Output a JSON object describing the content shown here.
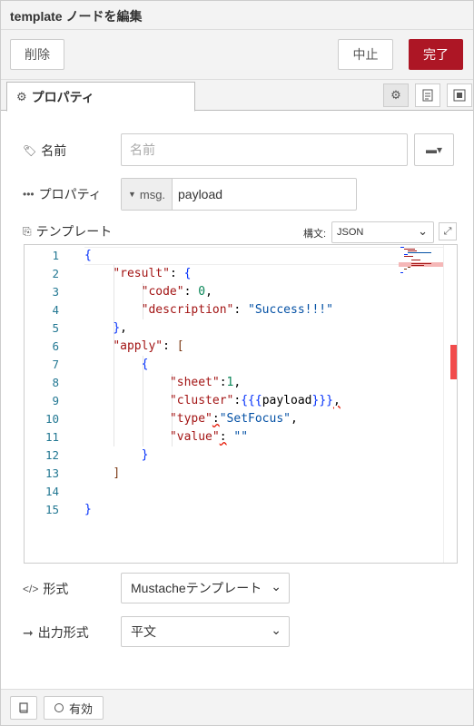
{
  "window": {
    "title": "template ノードを編集"
  },
  "buttons": {
    "delete": "削除",
    "cancel": "中止",
    "done": "完了"
  },
  "tabs": {
    "properties": "プロパティ"
  },
  "form": {
    "name": {
      "label": "名前",
      "placeholder": "名前",
      "value": ""
    },
    "property": {
      "label": "プロパティ",
      "prefix": "msg.",
      "value": "payload"
    },
    "template": {
      "label": "テンプレート",
      "syntax_label": "構文:",
      "syntax_value": "JSON"
    },
    "format": {
      "label": "形式",
      "value": "Mustacheテンプレート"
    },
    "output": {
      "label": "出力形式",
      "value": "平文"
    }
  },
  "editor": {
    "line_numbers": [
      "1",
      "2",
      "3",
      "4",
      "5",
      "6",
      "7",
      "8",
      "9",
      "10",
      "11",
      "12",
      "13",
      "14",
      "15"
    ],
    "lines": [
      "{",
      "    \"result\": {",
      "        \"code\": 0,",
      "        \"description\": \"Success!!!\"",
      "    },",
      "    \"apply\": [",
      "        {",
      "            \"sheet\":1,",
      "            \"cluster\":{{{payload}}},",
      "            \"type\":\"SetFocus\",",
      "            \"value\": \"\"",
      "        }",
      "    ]",
      "",
      "}"
    ]
  },
  "footer": {
    "enabled_label": "有効"
  },
  "colors": {
    "accent": "#ad1625",
    "key": "#a31515",
    "string": "#0451a5",
    "number": "#098658",
    "brace": "#0431fa",
    "line_number": "#237893"
  },
  "icons": [
    "gear-icon",
    "info-icon",
    "layout-icon",
    "tag-icon",
    "ellipsis-icon",
    "template-icon",
    "code-icon",
    "arrow-right-icon",
    "book-icon",
    "expand-icon",
    "chevron-down-icon"
  ]
}
